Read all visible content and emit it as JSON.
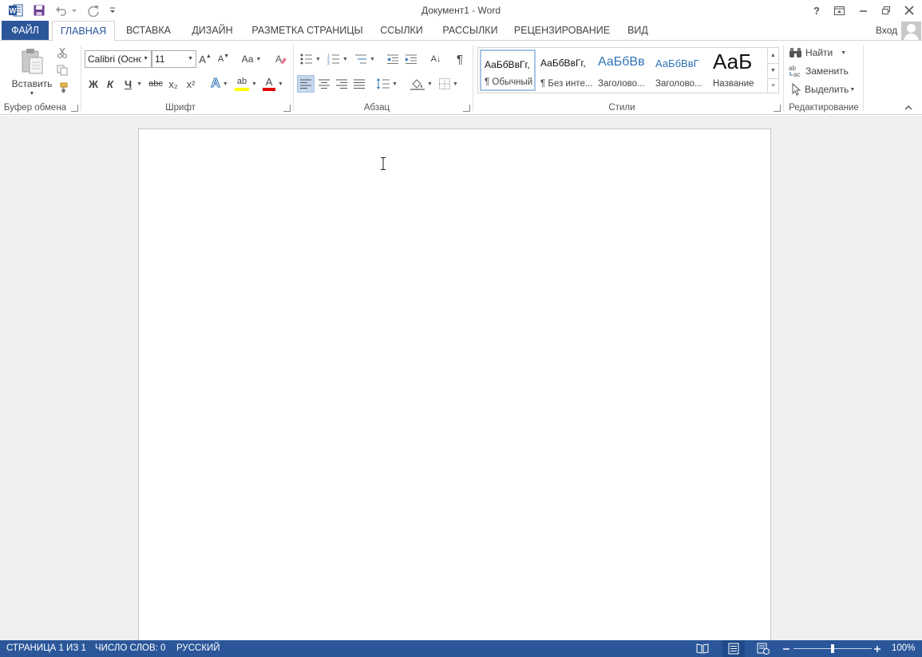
{
  "window": {
    "title": "Документ1 - Word",
    "help_label": "?"
  },
  "tabs": [
    {
      "label": "ФАЙЛ"
    },
    {
      "label": "ГЛАВНАЯ"
    },
    {
      "label": "ВСТАВКА"
    },
    {
      "label": "ДИЗАЙН"
    },
    {
      "label": "РАЗМЕТКА СТРАНИЦЫ"
    },
    {
      "label": "ССЫЛКИ"
    },
    {
      "label": "РАССЫЛКИ"
    },
    {
      "label": "РЕЦЕНЗИРОВАНИЕ"
    },
    {
      "label": "ВИД"
    }
  ],
  "user": {
    "login_label": "Вход"
  },
  "ribbon": {
    "clipboard": {
      "paste_label": "Вставить",
      "group_label": "Буфер обмена"
    },
    "font": {
      "font_name": "Calibri (Осно",
      "font_size": "11",
      "change_case_label": "Аа",
      "bold_label": "Ж",
      "italic_label": "К",
      "underline_label": "Ч",
      "strike_label": "abc",
      "subscript_label": "x₂",
      "superscript_label": "x²",
      "text_effects_label": "A",
      "highlight_label": "ab",
      "font_color_label": "A",
      "group_label": "Шрифт",
      "highlight_color": "#ffff00",
      "font_color": "#e00000"
    },
    "paragraph": {
      "sort_label": "А↓",
      "pilcrow_label": "¶",
      "group_label": "Абзац"
    },
    "styles": {
      "items": [
        {
          "sample": "АаБбВвГг,",
          "name": "¶ Обычный",
          "selected": true
        },
        {
          "sample": "АаБбВвГг,",
          "name": "¶ Без инте..."
        },
        {
          "sample": "АаБбВв",
          "name": "Заголово..."
        },
        {
          "sample": "АаБбВвГ",
          "name": "Заголово..."
        },
        {
          "sample": "АаБ",
          "name": "Название"
        }
      ],
      "group_label": "Стили",
      "heading_color": "#2e74b5"
    },
    "editing": {
      "find_label": "Найти",
      "replace_label": "Заменить",
      "select_label": "Выделить",
      "group_label": "Редактирование"
    }
  },
  "statusbar": {
    "page": "СТРАНИЦА 1 ИЗ 1",
    "words": "ЧИСЛО СЛОВ: 0",
    "language": "РУССКИЙ",
    "zoom": "100%",
    "zoom_level": 100
  },
  "colors": {
    "accent": "#2b579a",
    "doc_background": "#f0f0f0"
  }
}
